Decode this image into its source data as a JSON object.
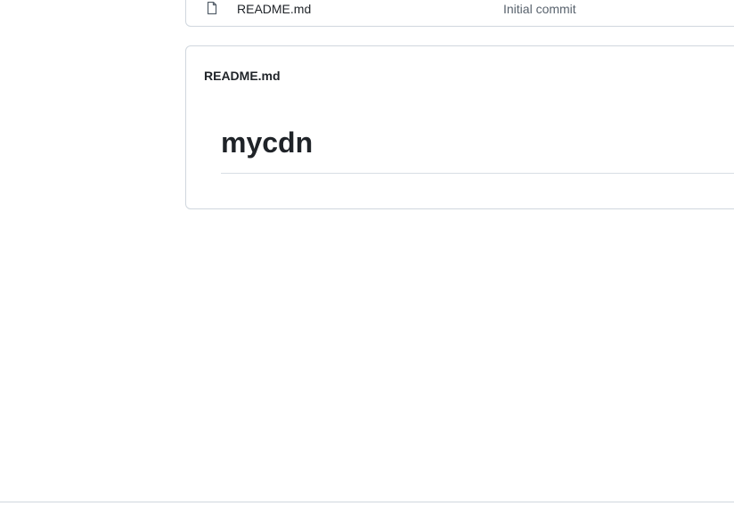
{
  "file_list": {
    "rows": [
      {
        "icon": "file-icon",
        "name": "README.md",
        "commit_message": "Initial commit"
      }
    ]
  },
  "readme": {
    "header": "README.md",
    "title": "mycdn"
  }
}
